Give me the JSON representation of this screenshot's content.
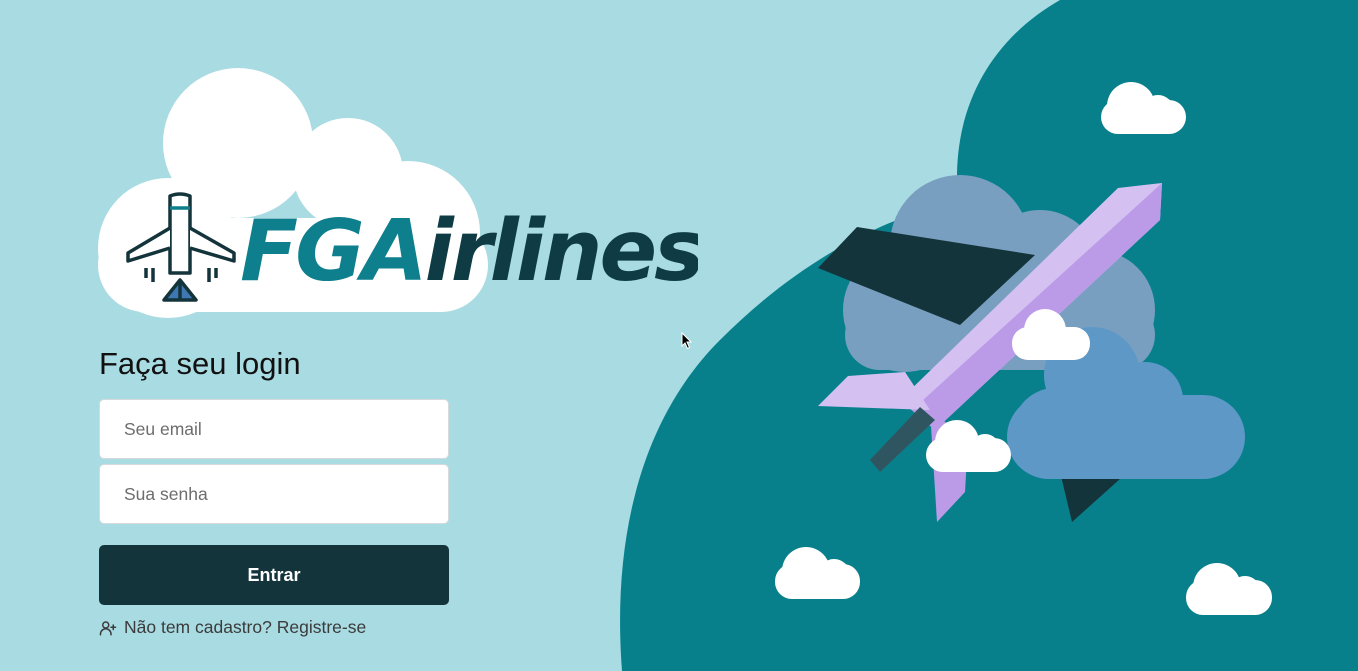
{
  "brand": {
    "name_part1": "FGA",
    "name_part2": "irlines",
    "color_part1": "#0e7f8c",
    "color_part2": "#0f3c44"
  },
  "login": {
    "heading": "Faça seu login",
    "email_placeholder": "Seu email",
    "password_placeholder": "Sua senha",
    "submit_label": "Entrar",
    "register_link": "Não tem cadastro? Registre-se"
  },
  "icons": {
    "logo": "airplane-icon",
    "register": "user-plus-icon"
  },
  "colors": {
    "background": "#a9dbe2",
    "accent_teal": "#08808c",
    "button": "#14343b",
    "plane_body": "#d4c1f2"
  }
}
